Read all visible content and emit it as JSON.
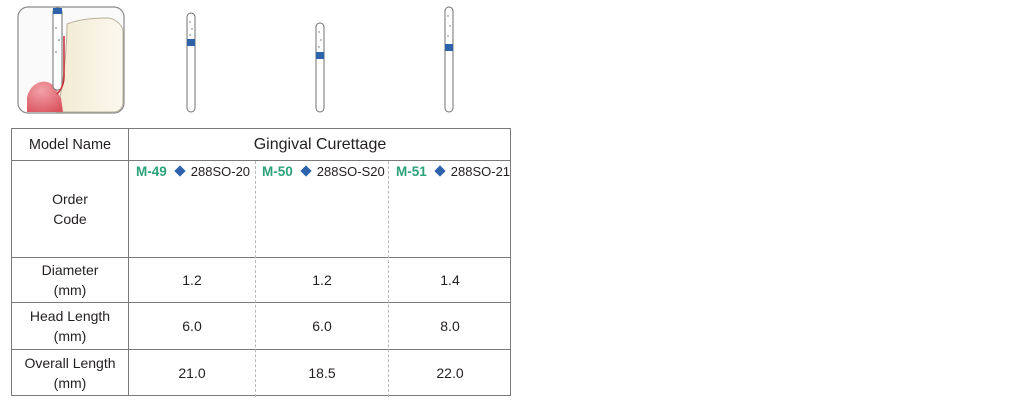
{
  "table": {
    "header": {
      "label": "Model Name",
      "group_title": "Gingival Curettage"
    },
    "order_code_label": "Order\nCode",
    "products": [
      {
        "model": "M-49",
        "code": "288SO-20"
      },
      {
        "model": "M-50",
        "code": "288SO-S20"
      },
      {
        "model": "M-51",
        "code": "288SO-21"
      }
    ],
    "rows": [
      {
        "label": "Diameter\n(mm)",
        "values": [
          "1.2",
          "1.2",
          "1.4"
        ]
      },
      {
        "label": "Head Length\n(mm)",
        "values": [
          "6.0",
          "6.0",
          "8.0"
        ]
      },
      {
        "label": "Overall Length\n(mm)",
        "values": [
          "21.0",
          "18.5",
          "22.0"
        ]
      }
    ]
  },
  "colors": {
    "model_code": "#2aa37a",
    "diamond": "#2e63ab",
    "bur_band": "#2e63ab",
    "gum": "#e47a82"
  },
  "illustrations": [
    {
      "name": "tooth-with-bur-illustration"
    },
    {
      "name": "bur-m49-illustration"
    },
    {
      "name": "bur-m50-illustration"
    },
    {
      "name": "bur-m51-illustration"
    }
  ]
}
